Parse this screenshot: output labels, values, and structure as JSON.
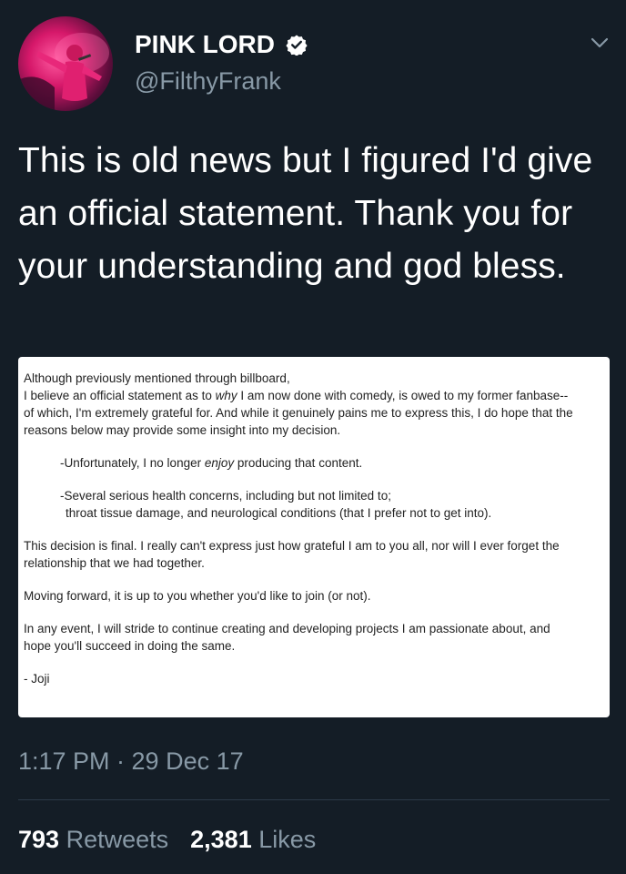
{
  "theme": {
    "background": "#141d26",
    "secondary_text": "#8899a6",
    "divider": "#2c3a48",
    "verified_badge": "#ffffff"
  },
  "author": {
    "display_name": "PINK LORD",
    "handle": "@FilthyFrank",
    "verified": true,
    "avatar_icon": "avatar-photo"
  },
  "tweet": {
    "text": "This is old news but I figured I'd give an official statement. Thank you for your understanding and god bless.",
    "timestamp": "1:17 PM · 29 Dec 17"
  },
  "attachment": {
    "para1_line1": "Although previously mentioned through billboard,",
    "para1_line2_pre": "I believe an official statement as to ",
    "para1_line2_em": "why",
    "para1_line2_post": " I am now done with comedy, is owed to my former fanbase--",
    "para1_line3": "of which, I'm extremely grateful for. And while it genuinely pains me to express this, I do hope that the",
    "para1_line4": "reasons below may provide some insight into my decision.",
    "bullet1_pre": "-Unfortunately, I no longer ",
    "bullet1_em": "enjoy",
    "bullet1_post": " producing that content.",
    "bullet2_line1": "-Several serious health concerns, including but not limited to;",
    "bullet2_line2": "throat tissue damage, and neurological conditions (that I prefer not to get into).",
    "para2_line1": "This decision is final. I really can't express just how grateful I am to you all, nor will I ever forget the",
    "para2_line2": "relationship that we had together.",
    "para3": "Moving forward, it is up to you whether you'd like to join (or not).",
    "para4_line1": "In any event, I will stride to continue creating and developing projects I am passionate about, and",
    "para4_line2": "hope you'll succeed in doing the same.",
    "signature": "- Joji"
  },
  "stats": {
    "retweets_count": "793",
    "retweets_label": "Retweets",
    "likes_count": "2,381",
    "likes_label": "Likes"
  }
}
